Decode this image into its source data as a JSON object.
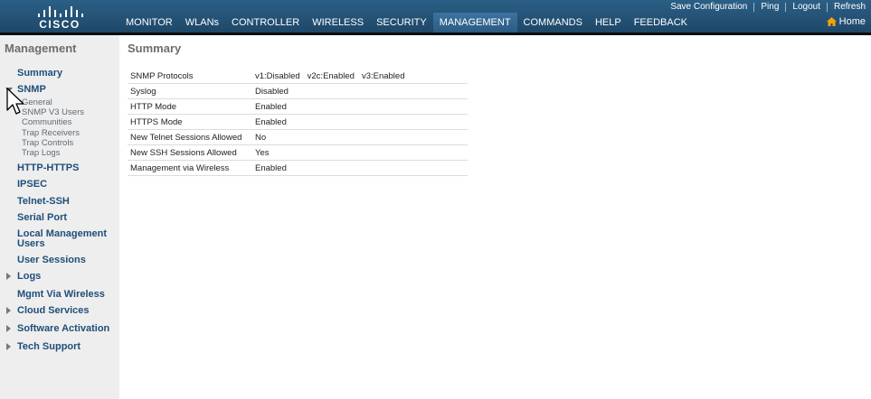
{
  "brand": {
    "logo_text": "CISCO"
  },
  "top_links": [
    "Save Configuration",
    "Ping",
    "Logout",
    "Refresh"
  ],
  "nav": {
    "items": [
      "MONITOR",
      "WLANs",
      "CONTROLLER",
      "WIRELESS",
      "SECURITY",
      "MANAGEMENT",
      "COMMANDS",
      "HELP",
      "FEEDBACK"
    ],
    "active": "MANAGEMENT",
    "home_label": "Home"
  },
  "sidebar": {
    "title": "Management",
    "items": [
      {
        "label": "Summary"
      },
      {
        "label": "SNMP",
        "expanded": true,
        "subitems": [
          "General",
          "SNMP V3 Users",
          "Communities",
          "Trap Receivers",
          "Trap Controls",
          "Trap Logs"
        ]
      },
      {
        "label": "HTTP-HTTPS"
      },
      {
        "label": "IPSEC"
      },
      {
        "label": "Telnet-SSH"
      },
      {
        "label": "Serial Port"
      },
      {
        "label": "Local Management Users"
      },
      {
        "label": "User Sessions"
      },
      {
        "label": "Logs",
        "collapsible": true
      },
      {
        "label": "Mgmt Via Wireless"
      },
      {
        "label": "Cloud Services",
        "collapsible": true
      },
      {
        "label": "Software Activation",
        "collapsible": true
      },
      {
        "label": "Tech Support",
        "collapsible": true
      }
    ]
  },
  "main": {
    "title": "Summary",
    "rows": [
      {
        "label": "SNMP Protocols",
        "values": [
          "v1:Disabled",
          "v2c:Enabled",
          "v3:Enabled"
        ]
      },
      {
        "label": "Syslog",
        "value": "Disabled"
      },
      {
        "label": "HTTP Mode",
        "value": "Enabled"
      },
      {
        "label": "HTTPS Mode",
        "value": "Enabled"
      },
      {
        "label": "New Telnet Sessions Allowed",
        "value": "No"
      },
      {
        "label": "New SSH Sessions Allowed",
        "value": "Yes"
      },
      {
        "label": "Management via Wireless",
        "value": "Enabled"
      }
    ]
  },
  "colors": {
    "header": "#24577c",
    "active_underline": "#f2a20c",
    "sidebar_bg": "#eeeeee",
    "sidebar_link": "#1f4e79"
  },
  "icons": {
    "home": "home-icon",
    "expand": "triangle-right-icon",
    "collapse": "triangle-down-icon",
    "cursor": "mouse-pointer-icon"
  }
}
